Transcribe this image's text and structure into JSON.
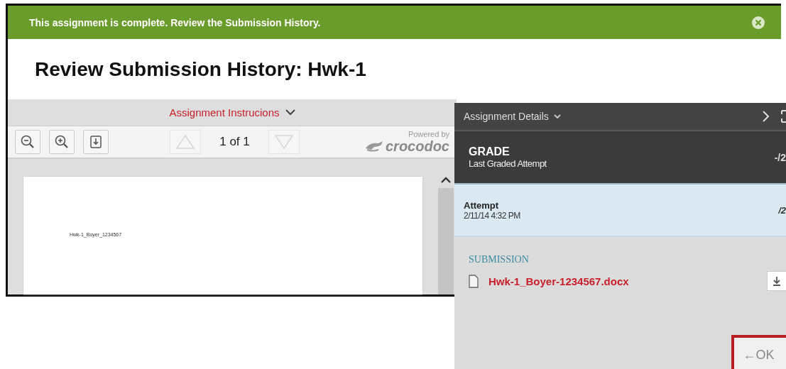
{
  "banner": {
    "message": "This assignment is complete. Review the Submission History."
  },
  "page_title": "Review Submission History: Hwk-1",
  "viewer": {
    "instructions_label": "Assignment Instrucions",
    "toolbar": [
      {
        "kind": "zoom-out"
      },
      {
        "kind": "zoom-in"
      },
      {
        "kind": "download"
      }
    ],
    "pager": {
      "previous_disabled": true,
      "next_disabled": true,
      "page": "1 of 1"
    },
    "branding": {
      "caption": "Powered by",
      "name": "crocodoc"
    },
    "document_text": "Hwk-1_Boyer_1234567"
  },
  "details": {
    "header": "Assignment Details",
    "grade": {
      "title": "GRADE",
      "subtitle": "Last Graded Attempt",
      "score": "-/2"
    },
    "attempt": {
      "title": "Attempt",
      "date": "2/11/14 4:32 PM",
      "score": "/2"
    },
    "submission": {
      "heading": "SUBMISSION",
      "file": "Hwk-1_Boyer-1234567.docx"
    },
    "ok_button": "←OK"
  }
}
